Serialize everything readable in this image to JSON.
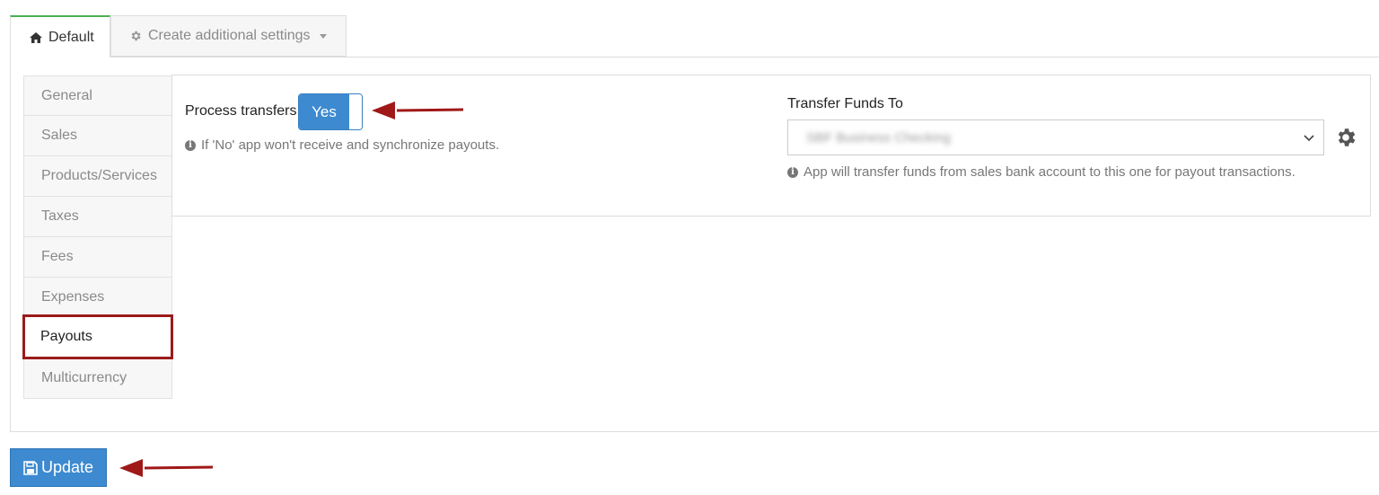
{
  "tabs": [
    {
      "label": "Default",
      "icon": "home-icon",
      "active": true
    },
    {
      "label": "Create additional settings",
      "icon": "gear-icon",
      "active": false
    }
  ],
  "sidebar": {
    "items": [
      {
        "label": "General"
      },
      {
        "label": "Sales"
      },
      {
        "label": "Products/Services"
      },
      {
        "label": "Taxes"
      },
      {
        "label": "Fees"
      },
      {
        "label": "Expenses"
      },
      {
        "label": "Payouts",
        "selected": true
      },
      {
        "label": "Multicurrency"
      }
    ]
  },
  "process_transfers": {
    "label": "Process transfers",
    "toggle_value": "Yes",
    "help": "If 'No' app won't receive and synchronize payouts."
  },
  "transfer_funds": {
    "label": "Transfer Funds To",
    "selected_value": "SBF Business Checking",
    "help": "App will transfer funds from sales bank account to this one for payout transactions."
  },
  "update_button": {
    "label": "Update"
  },
  "colors": {
    "primary": "#3d8ad0",
    "active_tab_border": "#4caf50",
    "highlight": "#9b1b1b"
  }
}
